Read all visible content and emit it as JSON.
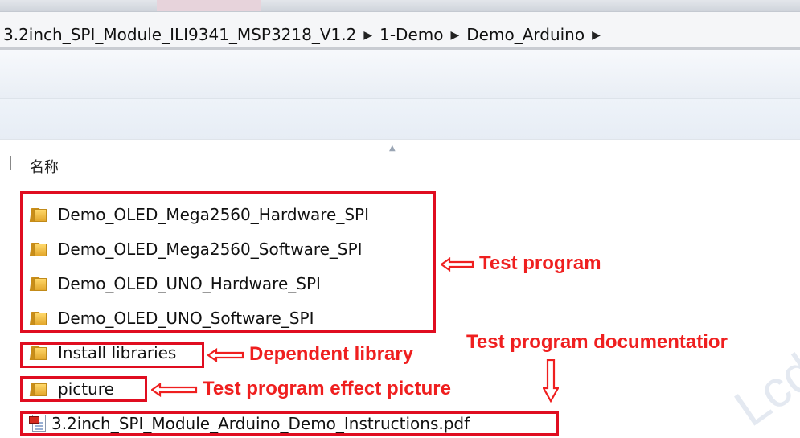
{
  "breadcrumb": [
    "3.2inch_SPI_Module_ILI9341_MSP3218_V1.2",
    "1-Demo",
    "Demo_Arduino"
  ],
  "column_header": "名称",
  "files": [
    {
      "name": "Demo_OLED_Mega2560_Hardware_SPI",
      "icon": "folder-icon"
    },
    {
      "name": "Demo_OLED_Mega2560_Software_SPI",
      "icon": "folder-icon"
    },
    {
      "name": "Demo_OLED_UNO_Hardware_SPI",
      "icon": "folder-icon"
    },
    {
      "name": "Demo_OLED_UNO_Software_SPI",
      "icon": "folder-icon"
    },
    {
      "name": "Install libraries",
      "icon": "folder-icon"
    },
    {
      "name": "picture",
      "icon": "folder-icon"
    },
    {
      "name": "3.2inch_SPI_Module_Arduino_Demo_Instructions.pdf",
      "icon": "pdf-file-icon"
    }
  ],
  "annotations": {
    "test_program": "Test program",
    "dependent_library": "Dependent library",
    "documentation": "Test program documentatior",
    "effect_picture": "Test program effect picture"
  },
  "colors": {
    "annotation_red": "#e00d20"
  },
  "watermark": "Lcd"
}
